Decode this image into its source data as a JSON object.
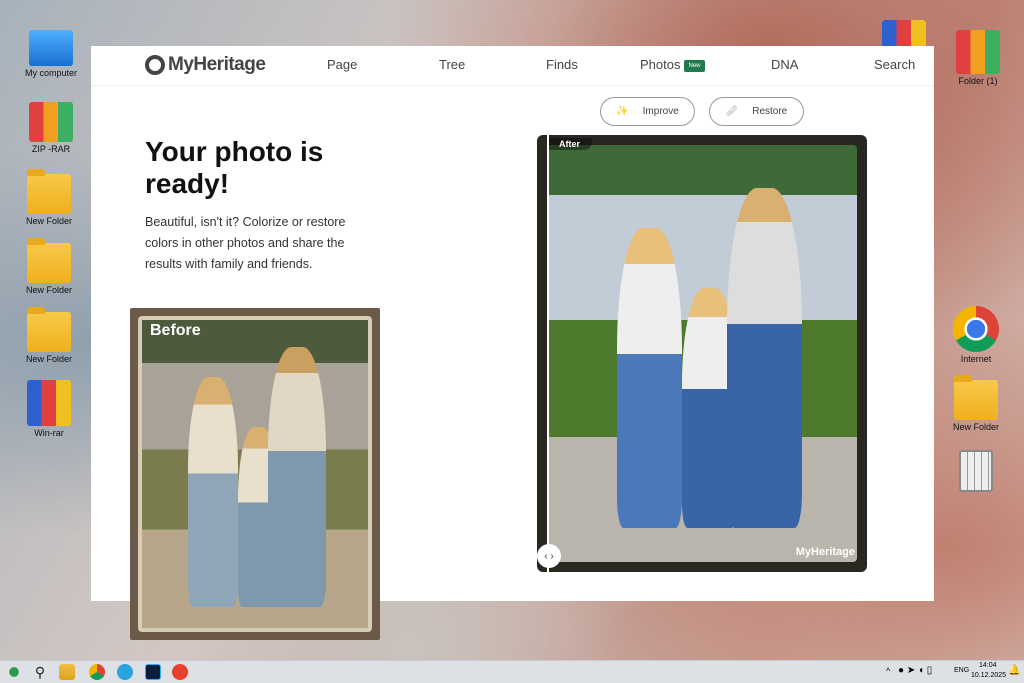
{
  "desktop": {
    "left": [
      "My computer",
      "ZIP -RAR",
      "New Folder",
      "New Folder",
      "New Folder",
      "Win-rar"
    ],
    "right": [
      "Folder (1)",
      "Internet",
      "New Folder"
    ]
  },
  "nav": {
    "logo": "MyHeritage",
    "items": [
      "Page",
      "Tree",
      "Finds",
      "Photos",
      "DNA",
      "Search"
    ],
    "new_badge": "New"
  },
  "actions": {
    "improve": "Improve",
    "restore": "Restore"
  },
  "hero": {
    "title": "Your photo is ready!",
    "description": "Beautiful, isn't it? Colorize or restore colors in other photos and share the results with family and friends."
  },
  "photos": {
    "before_label": "Before",
    "after_label": "After",
    "watermark": "MyHeritage"
  },
  "taskbar": {
    "lang": "ENG",
    "time": "14:04",
    "date": "10.12.2025"
  }
}
